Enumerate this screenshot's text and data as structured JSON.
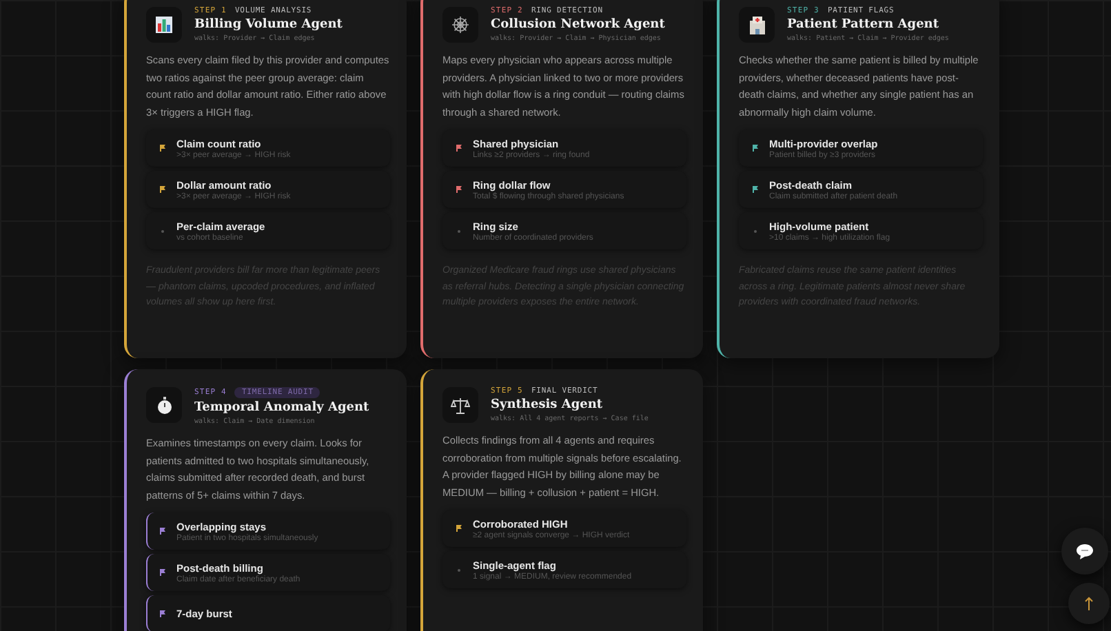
{
  "agents": [
    {
      "step": "STEP 1",
      "tag": "VOLUME ANALYSIS",
      "active": false,
      "color": "#d4a53a",
      "title": "Billing Volume Agent",
      "walks": "walks: Provider → Claim edges",
      "description": "Scans every claim filed by this provider and computes two ratios against the peer group average: claim count ratio and dollar amount ratio. Either ratio above 3× triggers a HIGH flag.",
      "signals": [
        {
          "name": "Claim count ratio",
          "detail": ">3× peer average → HIGH risk",
          "flagged": true
        },
        {
          "name": "Dollar amount ratio",
          "detail": ">3× peer average → HIGH risk",
          "flagged": true
        },
        {
          "name": "Per-claim average",
          "detail": "vs cohort baseline",
          "flagged": false
        }
      ],
      "note": "Fraudulent providers bill far more than legitimate peers — phantom claims, upcoded procedures, and inflated volumes all show up here first."
    },
    {
      "step": "STEP 2",
      "tag": "RING DETECTION",
      "active": false,
      "color": "#e06c6c",
      "title": "Collusion Network Agent",
      "walks": "walks: Provider → Claim → Physician edges",
      "description": "Maps every physician who appears across multiple providers. A physician linked to two or more providers with high dollar flow is a ring conduit — routing claims through a shared network.",
      "signals": [
        {
          "name": "Shared physician",
          "detail": "Links ≥2 providers → ring found",
          "flagged": true
        },
        {
          "name": "Ring dollar flow",
          "detail": "Total $ flowing through shared physicians",
          "flagged": true
        },
        {
          "name": "Ring size",
          "detail": "Number of coordinated providers",
          "flagged": false
        }
      ],
      "note": "Organized Medicare fraud rings use shared physicians as referral hubs. Detecting a single physician connecting multiple providers exposes the entire network."
    },
    {
      "step": "STEP 3",
      "tag": "PATIENT FLAGS",
      "active": false,
      "color": "#4fb3a9",
      "title": "Patient Pattern Agent",
      "walks": "walks: Patient → Claim → Provider edges",
      "description": "Checks whether the same patient is billed by multiple providers, whether deceased patients have post-death claims, and whether any single patient has an abnormally high claim volume.",
      "signals": [
        {
          "name": "Multi-provider overlap",
          "detail": "Patient billed by ≥3 providers",
          "flagged": true
        },
        {
          "name": "Post-death claim",
          "detail": "Claim submitted after patient death",
          "flagged": true
        },
        {
          "name": "High-volume patient",
          "detail": ">10 claims → high utilization flag",
          "flagged": false
        }
      ],
      "note": "Fabricated claims reuse the same patient identities across a ring. Legitimate patients almost never share providers with coordinated fraud networks."
    },
    {
      "step": "STEP 4",
      "tag": "TIMELINE AUDIT",
      "active": true,
      "color": "#9b7fd4",
      "title": "Temporal Anomaly Agent",
      "walks": "walks: Claim → Date dimension",
      "description": "Examines timestamps on every claim. Looks for patients admitted to two hospitals simultaneously, claims submitted after recorded death, and burst patterns of 5+ claims within 7 days.",
      "signals": [
        {
          "name": "Overlapping stays",
          "detail": "Patient in two hospitals simultaneously",
          "flagged": true
        },
        {
          "name": "Post-death billing",
          "detail": "Claim date after beneficiary death",
          "flagged": true
        },
        {
          "name": "7-day burst",
          "flagged": true
        }
      ]
    },
    {
      "step": "STEP 5",
      "tag": "FINAL VERDICT",
      "active": false,
      "color": "#d4a53a",
      "title": "Synthesis Agent",
      "walks": "walks: All 4 agent reports → Case file",
      "description": "Collects findings from all 4 agents and requires corroboration from multiple signals before escalating. A provider flagged HIGH by billing alone may be MEDIUM — billing + collusion + patient = HIGH.",
      "signals": [
        {
          "name": "Corroborated HIGH",
          "detail": "≥2 agent signals converge → HIGH verdict",
          "flagged": true
        },
        {
          "name": "Single-agent flag",
          "detail": "1 signal → MEDIUM, review recommended",
          "flagged": false
        }
      ]
    }
  ]
}
